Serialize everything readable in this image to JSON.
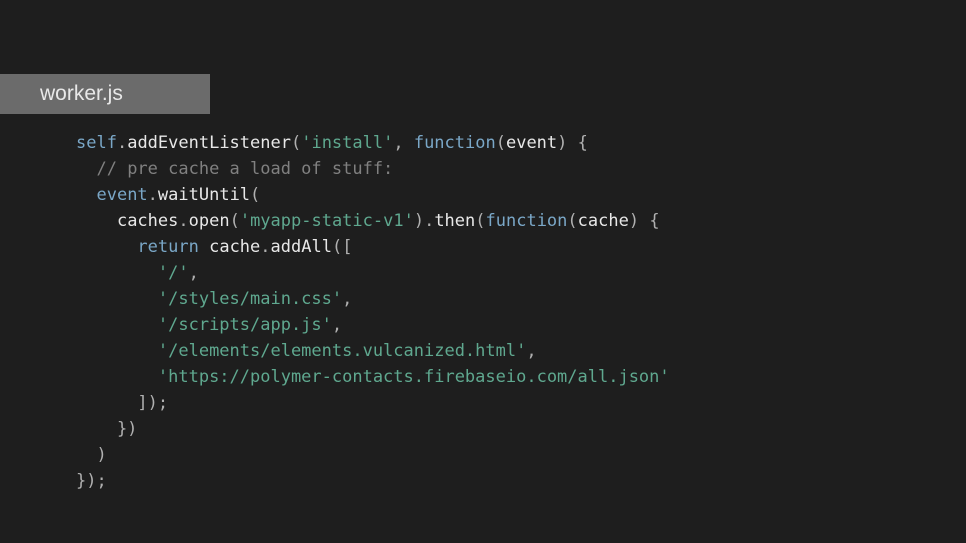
{
  "tab": {
    "filename": "worker.js"
  },
  "code": {
    "lines": [
      [
        {
          "t": "self",
          "c": "var"
        },
        {
          "t": ".",
          "c": "punct"
        },
        {
          "t": "addEventListener",
          "c": "method"
        },
        {
          "t": "(",
          "c": "punct"
        },
        {
          "t": "'install'",
          "c": "string"
        },
        {
          "t": ", ",
          "c": "punct"
        },
        {
          "t": "function",
          "c": "keyword"
        },
        {
          "t": "(",
          "c": "punct"
        },
        {
          "t": "event",
          "c": "ident"
        },
        {
          "t": ") {",
          "c": "punct"
        }
      ],
      [
        {
          "t": "  ",
          "c": "punct"
        },
        {
          "t": "// pre cache a load of stuff:",
          "c": "comment"
        }
      ],
      [
        {
          "t": "  ",
          "c": "punct"
        },
        {
          "t": "event",
          "c": "var"
        },
        {
          "t": ".",
          "c": "punct"
        },
        {
          "t": "waitUntil",
          "c": "method"
        },
        {
          "t": "(",
          "c": "punct"
        }
      ],
      [
        {
          "t": "    ",
          "c": "punct"
        },
        {
          "t": "caches",
          "c": "ident"
        },
        {
          "t": ".",
          "c": "punct"
        },
        {
          "t": "open",
          "c": "method"
        },
        {
          "t": "(",
          "c": "punct"
        },
        {
          "t": "'myapp-static-v1'",
          "c": "string"
        },
        {
          "t": ").",
          "c": "punct"
        },
        {
          "t": "then",
          "c": "method"
        },
        {
          "t": "(",
          "c": "punct"
        },
        {
          "t": "function",
          "c": "keyword"
        },
        {
          "t": "(",
          "c": "punct"
        },
        {
          "t": "cache",
          "c": "ident"
        },
        {
          "t": ") {",
          "c": "punct"
        }
      ],
      [
        {
          "t": "      ",
          "c": "punct"
        },
        {
          "t": "return",
          "c": "keyword"
        },
        {
          "t": " ",
          "c": "punct"
        },
        {
          "t": "cache",
          "c": "ident"
        },
        {
          "t": ".",
          "c": "punct"
        },
        {
          "t": "addAll",
          "c": "method"
        },
        {
          "t": "([",
          "c": "punct"
        }
      ],
      [
        {
          "t": "        ",
          "c": "punct"
        },
        {
          "t": "'/'",
          "c": "string"
        },
        {
          "t": ",",
          "c": "punct"
        }
      ],
      [
        {
          "t": "        ",
          "c": "punct"
        },
        {
          "t": "'/styles/main.css'",
          "c": "string"
        },
        {
          "t": ",",
          "c": "punct"
        }
      ],
      [
        {
          "t": "        ",
          "c": "punct"
        },
        {
          "t": "'/scripts/app.js'",
          "c": "string"
        },
        {
          "t": ",",
          "c": "punct"
        }
      ],
      [
        {
          "t": "        ",
          "c": "punct"
        },
        {
          "t": "'/elements/elements.vulcanized.html'",
          "c": "string"
        },
        {
          "t": ",",
          "c": "punct"
        }
      ],
      [
        {
          "t": "        ",
          "c": "punct"
        },
        {
          "t": "'https://polymer-contacts.firebaseio.com/all.json'",
          "c": "string"
        }
      ],
      [
        {
          "t": "      ]);",
          "c": "punct"
        }
      ],
      [
        {
          "t": "    })",
          "c": "punct"
        }
      ],
      [
        {
          "t": "  )",
          "c": "punct"
        }
      ],
      [
        {
          "t": "});",
          "c": "punct"
        }
      ]
    ]
  }
}
